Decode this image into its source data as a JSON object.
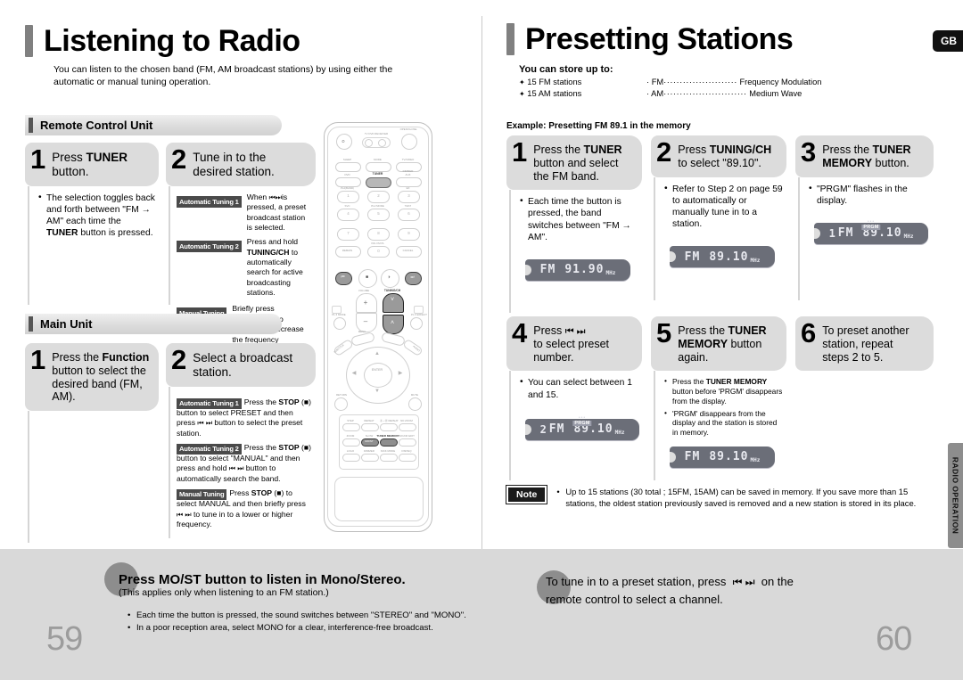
{
  "left_page": {
    "title": "Listening to Radio",
    "intro": "You can listen to the chosen band (FM, AM broadcast stations) by using either the automatic or manual tuning operation.",
    "page_number": "59",
    "sections": [
      {
        "heading": "Remote Control Unit",
        "steps": [
          {
            "number": "1",
            "title_plain": "Press TUNER button.",
            "title_pre": "Press ",
            "title_bold": "TUNER",
            "title_post": " button.",
            "bullets": [
              "The selection toggles back and forth between \"FM → AM\" each time the TUNER button is pressed."
            ]
          },
          {
            "number": "2",
            "title_plain": "Tune in to the desired station.",
            "tuning_rows": [
              {
                "badge": "Automatic Tuning 1",
                "text": "When ❘◀◀ ▶▶❘ is pressed, a preset broadcast station is selected."
              },
              {
                "badge": "Automatic Tuning 2",
                "text": "Press and hold TUNING/CH to automatically search for active broadcasting stations."
              },
              {
                "badge": "Manual Tuning",
                "text": "Briefly press TUNING/CH to increase or decrease the frequency incrementally."
              }
            ]
          }
        ]
      },
      {
        "heading": "Main Unit",
        "steps": [
          {
            "number": "1",
            "title_plain": "Press the Function button to select the desired band (FM, AM).",
            "bullets": []
          },
          {
            "number": "2",
            "title_plain": "Select a broadcast station.",
            "tuning_rows": [
              {
                "badge": "Automatic Tuning 1",
                "text": "Press the STOP (■) button to select PRESET and then press ❘◀◀ ▶▶❘ button to select the preset station."
              },
              {
                "badge": "Automatic Tuning 2",
                "text": "Press the STOP (■) button to select \"MANUAL\" and then press and hold ❘◀◀ ▶▶❘ button to automatically search the band."
              },
              {
                "badge": "Manual Tuning",
                "text": "Press STOP (■) to select MANUAL and then briefly press ❘◀◀ ▶▶❘ to tune in to a lower or higher frequency."
              }
            ]
          }
        ]
      }
    ]
  },
  "right_page": {
    "title": "Presetting Stations",
    "lang_tab": "GB",
    "side_tab": "RADIO OPERATION",
    "page_number": "60",
    "store_title": "You can store up to:",
    "store_items": [
      "15 FM stations",
      "15 AM stations"
    ],
    "band_defs": [
      {
        "abbr": "FM",
        "dots": "·······················",
        "meaning": "Frequency Modulation"
      },
      {
        "abbr": "AM",
        "dots": "··························",
        "meaning": "Medium Wave"
      }
    ],
    "example_label": "Example: Presetting FM 89.1 in the memory",
    "steps": [
      {
        "number": "1",
        "title_plain": "Press the TUNER button and select the FM band.",
        "bullets": [
          "Each time the button is pressed, the band switches between \"FM → AM\"."
        ],
        "lcd": {
          "preset": "",
          "band": "FM",
          "freq": "91.90",
          "unit": "MHz",
          "prgm": false
        }
      },
      {
        "number": "2",
        "title_plain": "Press TUNING/CH to select \"89.10\".",
        "bullets": [
          "Refer to Step 2 on page 59 to automatically or manually tune in to a station."
        ],
        "lcd": {
          "preset": "",
          "band": "FM",
          "freq": "89.10",
          "unit": "MHz",
          "prgm": false
        }
      },
      {
        "number": "3",
        "title_plain": "Press the TUNER MEMORY button.",
        "bullets": [
          "\"PRGM\" flashes in the display."
        ],
        "lcd": {
          "preset": "1",
          "band": "FM",
          "freq": "89.10",
          "unit": "MHz",
          "prgm": true
        }
      },
      {
        "number": "4",
        "title_plain": "Press ❘◀◀ ▶▶❘ to select preset number.",
        "bullets": [
          "You can select between 1 and 15."
        ],
        "lcd": {
          "preset": "2",
          "band": "FM",
          "freq": "89.10",
          "unit": "MHz",
          "prgm": true
        }
      },
      {
        "number": "5",
        "title_plain": "Press the TUNER MEMORY button again.",
        "bullets": [
          "Press the TUNER MEMORY button before 'PRGM' disappears from the display.",
          "'PRGM' disappears from the display and the station is stored in memory."
        ],
        "lcd": {
          "preset": "",
          "band": "FM",
          "freq": "89.10",
          "unit": "MHz",
          "prgm": false
        }
      },
      {
        "number": "6",
        "title_plain": "To preset another station, repeat steps 2 to 5.",
        "bullets": [],
        "lcd": null
      }
    ],
    "note": {
      "label": "Note",
      "text": "Up to 15 stations (30 total ; 15FM, 15AM) can be saved in memory. If you save more than 15 stations, the oldest station previously saved is removed and a new station is stored in its place."
    }
  },
  "footer": {
    "left": {
      "title_pre": "Press ",
      "title_bold": "MO/ST",
      "title_post": " button to listen in Mono/Stereo.",
      "subtitle": "(This applies only when listening to an FM station.)",
      "bullets": [
        "Each time the button is pressed, the sound switches between \"STEREO\" and \"MONO\".",
        "In a poor reception area, select MONO for a clear, interference-free broadcast."
      ]
    },
    "right": {
      "line1": "To tune in to a preset station, press  ❘◀◀ ▶▶❘  on the",
      "line2": "remote control to select a channel."
    }
  },
  "remote": {
    "labels": {
      "open_close": "OPEN/CLOSE",
      "tv_dvd_receiver": "TV    DVD RECEIVER",
      "sleep": "SLEEP",
      "mode": "MODE",
      "tv_video": "TV/VIDEO",
      "dimmer": "DIMMER",
      "dvd": "DVD",
      "tuner": "TUNER",
      "aux": "AUX",
      "pl2_band": "PL2(BAND)",
      "ex": "EX",
      "svc": "SVC",
      "pl2_mode": "PL2 MODE",
      "test": "TEST",
      "remain": "REMAIN",
      "vol_fm_pl": "VOL FM PL",
      "cancel": "CANCEL",
      "volume": "VOLUME",
      "tuning_ch": "TUNING/CH",
      "pl2_mode_left": "PL II MODE",
      "pl2_effect_right": "PL II EFFECT",
      "menu": "MENU",
      "dvd_top": "DVD",
      "subtitle": "SUBTITLE",
      "audio": "AUDIO",
      "enter": "ENTER",
      "return": "RETURN",
      "mute": "MUTE",
      "step": "STEP",
      "repeat": "REPEAT",
      "ab_repeat": "Ⓐ↔Ⓑ REPEAT",
      "nd_zoom": "ND ZOOM",
      "zoom": "ZOOM",
      "slow": "SLOW",
      "tuner_memory": "TUNER MEMORY",
      "sound_edit": "SOUND EDIT",
      "logo": "LOGO",
      "dimmer2": "DIMMER",
      "nick_mode": "NICK MODE",
      "dsp_eq": "DSP/EQ",
      "mo_st": "MO/ST"
    },
    "keypad": [
      "1",
      "2",
      "3",
      "4",
      "5",
      "6",
      "7",
      "8",
      "9",
      "0"
    ]
  }
}
